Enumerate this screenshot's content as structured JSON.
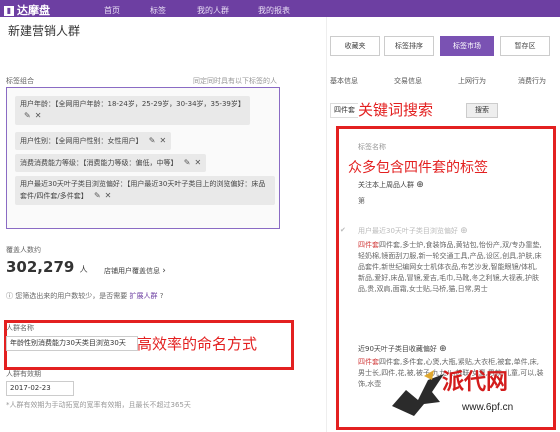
{
  "nav": {
    "logo": "达摩盘",
    "items": [
      "首页",
      "标签",
      "我的人群",
      "我的报表"
    ]
  },
  "page": {
    "title": "新建营销人群",
    "tags_label": "标签组合",
    "tags_hint": "同定同时具有以下标签的人",
    "chips": [
      "用户年龄：【全网用户年龄：18-24岁，25-29岁，30-34岁，35-39岁】",
      "用户性别：【全网用户性别：女性用户】",
      "消费消费能力等级：【消费能力等级：偏低，中等】",
      "用户最近30天叶子类目浏览偏好：【用户最近30天叶子类目上的浏览偏好：床品套件/四件套/多件套】"
    ],
    "estimate_label": "覆盖人数约",
    "estimate_value": "302,279",
    "estimate_unit": "人",
    "estimate_link": "店铺用户覆盖信息",
    "warning": "您筛选出来的用户数较少，是否需要",
    "warning_link": "扩展人群",
    "name_label": "人群名称",
    "name_value": "年龄性别消费能力30天类目浏览30天",
    "validity_label": "人群有效期",
    "validity_value": "2017-02-23",
    "validity_hint": "*人群有效期为手动拓宽的宽率有效期，且最长不超过365天"
  },
  "right": {
    "tabs": [
      "收藏夹",
      "标签排序",
      "标签市场",
      "暂存区"
    ],
    "active_tab": "标签市场",
    "subtabs": [
      "基本信息",
      "交易信息",
      "上网行为",
      "消费行为"
    ],
    "search_value": "四件套",
    "search_button": "搜索",
    "section_label": "标签名称",
    "item1_title": "关注本上周品人群",
    "item1_sub": "第",
    "item2_title": "用户最近30天叶子类目浏览偏好",
    "item2_text": "四件套,多士炉,食装饰品,黄钻包,怡份产,双/专办靠垫,轻奶棉,镜面刮刀服,新一轮交通工具,产品,设区,创具,护肤,床品套件,新世纪编网女士机体衣品,布艺沙发,智能眼镜/体机,新品,爱好,床品,冒镜,爱吉,毛巾,马靴,冬之利镜,大视表,护肤品,贵,双肩,面霜,女士贴,马桥,猫,日常,男士",
    "item3_title": "近90天叶子类目收藏偏好",
    "item3_text": "四件套,多件套,心煲,大瓶,紧贴,大衣柜,被套,单件,床,男士长,四件,花,被,被子,九九八,苏联,女夏,男款,儿童,可以,装饰,水壶"
  },
  "annotations": {
    "search": "关键词搜索",
    "tags": "众多包含四件套的标签",
    "naming": "高效率的命名方式"
  },
  "watermark": {
    "brand": "派代网",
    "url": "www.6pf.cn"
  },
  "colors": {
    "nav": "#6d3fa2",
    "active_tab": "#7a52b3",
    "annotation": "#e32020"
  }
}
